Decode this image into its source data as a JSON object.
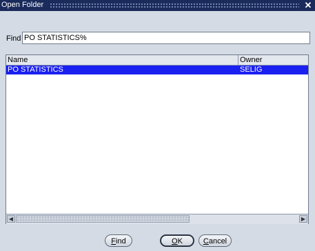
{
  "window": {
    "title": "Open Folder",
    "close_glyph": "✕"
  },
  "find": {
    "label": "Find",
    "value": "PO STATISTICS%"
  },
  "grid": {
    "columns": [
      "Name",
      "Owner"
    ],
    "rows": [
      {
        "name": "PO STATISTICS",
        "owner": "SELIG",
        "selected": true
      }
    ]
  },
  "scrollbar": {
    "left_glyph": "◀",
    "right_glyph": "▶"
  },
  "buttons": {
    "find": {
      "mnemonic": "F",
      "rest": "ind"
    },
    "ok": {
      "mnemonic": "O",
      "rest": "K"
    },
    "cancel": {
      "mnemonic": "C",
      "rest": "ancel"
    }
  },
  "colors": {
    "titlebar": "#1a2b5c",
    "selection": "#1a20f0"
  }
}
